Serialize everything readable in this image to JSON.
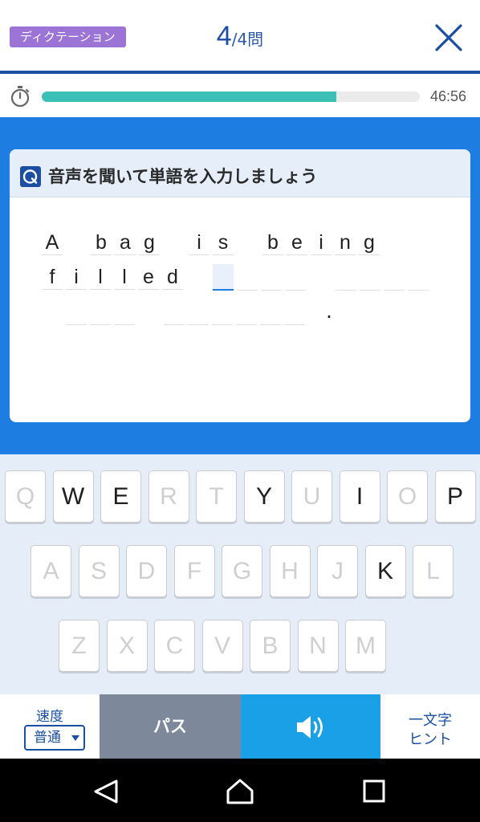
{
  "header": {
    "mode_label": "ディクテーション",
    "current": "4",
    "total": "/4問",
    "close_icon": "close-icon"
  },
  "progress": {
    "fraction": 0.78,
    "timer": "46:56",
    "timer_icon": "stopwatch-icon",
    "fill_color": "#3bbfb7"
  },
  "card": {
    "title": "音声を聞いて単語を入力しましょう",
    "title_icon": "question-icon"
  },
  "sentence": {
    "line1": [
      "A",
      "b",
      "a",
      "g",
      "i",
      "s",
      "b",
      "e",
      "i",
      "n",
      "g"
    ],
    "line2": [
      "f",
      "i",
      "l",
      "l",
      "e",
      "d"
    ],
    "period": "."
  },
  "keyboard": {
    "rows": [
      [
        {
          "k": "Q",
          "on": false
        },
        {
          "k": "W",
          "on": true
        },
        {
          "k": "E",
          "on": true
        },
        {
          "k": "R",
          "on": false
        },
        {
          "k": "T",
          "on": false
        },
        {
          "k": "Y",
          "on": true
        },
        {
          "k": "U",
          "on": false
        },
        {
          "k": "I",
          "on": true
        },
        {
          "k": "O",
          "on": false
        },
        {
          "k": "P",
          "on": true
        }
      ],
      [
        {
          "k": "A",
          "on": false
        },
        {
          "k": "S",
          "on": false
        },
        {
          "k": "D",
          "on": false
        },
        {
          "k": "F",
          "on": false
        },
        {
          "k": "G",
          "on": false
        },
        {
          "k": "H",
          "on": false
        },
        {
          "k": "J",
          "on": false
        },
        {
          "k": "K",
          "on": true
        },
        {
          "k": "L",
          "on": false
        }
      ],
      [
        {
          "k": "Z",
          "on": false
        },
        {
          "k": "X",
          "on": false
        },
        {
          "k": "C",
          "on": false
        },
        {
          "k": "V",
          "on": false
        },
        {
          "k": "B",
          "on": false
        },
        {
          "k": "N",
          "on": false
        },
        {
          "k": "M",
          "on": false
        }
      ]
    ]
  },
  "bottom": {
    "speed_label": "速度",
    "speed_value": "普通",
    "pass_label": "パス",
    "sound_icon": "speaker-icon",
    "hint_line1": "一文字",
    "hint_line2": "ヒント"
  },
  "nav": {
    "back_icon": "back-icon",
    "home_icon": "home-icon",
    "recent_icon": "recent-apps-icon"
  },
  "colors": {
    "primary": "#1a4fa3",
    "accent_blue": "#1e7de0",
    "badge_purple": "#9b74d6",
    "pass_gray": "#7d889b",
    "sound_blue": "#1aa0e6"
  }
}
